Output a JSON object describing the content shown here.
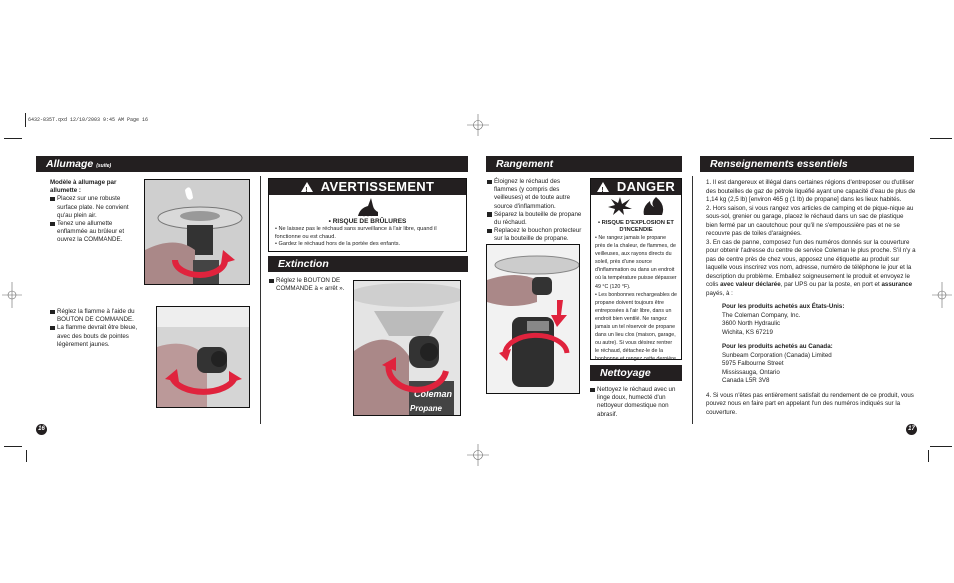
{
  "slug": "6432-835T.qxd  12/10/2003  9:45 AM  Page 16",
  "left_page": {
    "section_title": "Allumage",
    "section_suffix": "(suite)",
    "match_model_heading": "Modèle à allumage par allumette :",
    "match_steps": [
      "Placez sur une robuste surface plate. Ne convient qu'au plein air.",
      "Tenez une allumette enflammée au brûleur et ouvrez la COMMANDE."
    ],
    "flame_steps": [
      "Réglez la flamme à l'aide du BOUTON DE COMMANDE.",
      "La flamme devrait être bleue, avec des bouts de pointes légèrement jaunes."
    ],
    "warning": {
      "title": "AVERTISSEMENT",
      "icon": "burn-hazard-icon",
      "risk": "• RISQUE DE BRÛLURES",
      "items": [
        "• Ne laissez pas le réchaud sans surveillance à l'air libre, quand il fonctionne ou est chaud.",
        "• Gardez le réchaud hors de la portée des enfants."
      ]
    },
    "extinction": {
      "title": "Extinction",
      "steps": [
        "Réglez le BOUTON DE COMMANDE à « arrêt »."
      ]
    },
    "page_number": "16"
  },
  "right_page": {
    "rangement": {
      "title": "Rangement",
      "steps": [
        "Éloignez le réchaud des flammes (y compris des veilleuses) et de toute autre source d'inflammation.",
        "Séparez la bouteille de propane du réchaud.",
        "Replacez le bouchon protecteur sur la bouteille de propane."
      ]
    },
    "danger": {
      "title": "DANGER",
      "icons": [
        "explosion-icon",
        "fire-icon"
      ],
      "risk": "• RISQUE D'EXPLOSION ET D'INCENDIE",
      "items": [
        "• Ne rangez jamais le propane près de la chaleur, de flammes, de veilleuses, aux rayons directs du soleil, près d'une source d'inflammation ou dans un endroit où la température puisse dépasser 49 °C (120 °F).",
        "• Les bonbonnes rechargeables de propane doivent toujours être entreposées à l'air libre, dans un endroit bien ventilé. Ne rangez jamais un tel réservoir de propane dans un lieu clos (maison, garage, ou autre). Si vous désirez rentrer le réchaud, détachez-le de la bonbonne et rangez cette dernière dehors."
      ]
    },
    "nettoyage": {
      "title": "Nettoyage",
      "steps": [
        "Nettoyez le réchaud avec un linge doux, humecté d'un nettoyeur domestique non abrasif."
      ]
    },
    "renseignements": {
      "title": "Renseignements essentiels",
      "p1": "1. Il est dangereux et illégal dans certaines régions d'entreposer ou d'utiliser des bouteilles de gaz de pétrole liquéfié ayant une capacité d'eau de plus de 1,14 kg (2,5 lb) [environ 465 g (1 lb) de propane] dans les lieux habités.",
      "p2": "2. Hors saison, si vous rangez vos articles de camping et de pique-nique au sous-sol, grenier ou garage, placez le réchaud dans un sac de plastique bien fermé par un caoutchouc pour qu'il ne s'empoussière pas et ne se recouvre pas de toiles d'araignées.",
      "p3_a": "3. En cas de panne, composez l'un des numéros donnés sur la couverture pour obtenir l'adresse du centre de service Coleman le plus proche. S'il n'y a pas de centre près de chez vous, apposez une étiquette au produit sur laquelle vous inscrirez vos nom, adresse, numéro de téléphone le jour et la description du problème. Emballez soigneusement le produit et envoyez le colis ",
      "p3_b": "avec valeur déclarée",
      "p3_c": ", par UPS ou par la poste, en port et ",
      "p3_d": "assurance",
      "p3_e": " payés, à :",
      "us_heading": "Pour les produits achetés aux États-Unis:",
      "us_address": [
        "The Coleman Company, Inc.",
        "3600 North Hydraulic",
        "Wichita, KS 67219"
      ],
      "ca_heading": "Pour les produits achetés au Canada:",
      "ca_address": [
        "Sunbeam Corporation (Canada) Limited",
        "5975 Falbourne Street",
        "Mississauga, Ontario",
        "Canada L5R 3V8"
      ],
      "p4": "4. Si vous n'êtes pas entièrement satisfait du rendement de ce produit, vous pouvez nous en faire part en appelant l'un des numéros indiqués sur la couverture."
    },
    "page_number": "17"
  },
  "colors": {
    "bar": "#231f20",
    "arrow": "#e0233d"
  }
}
